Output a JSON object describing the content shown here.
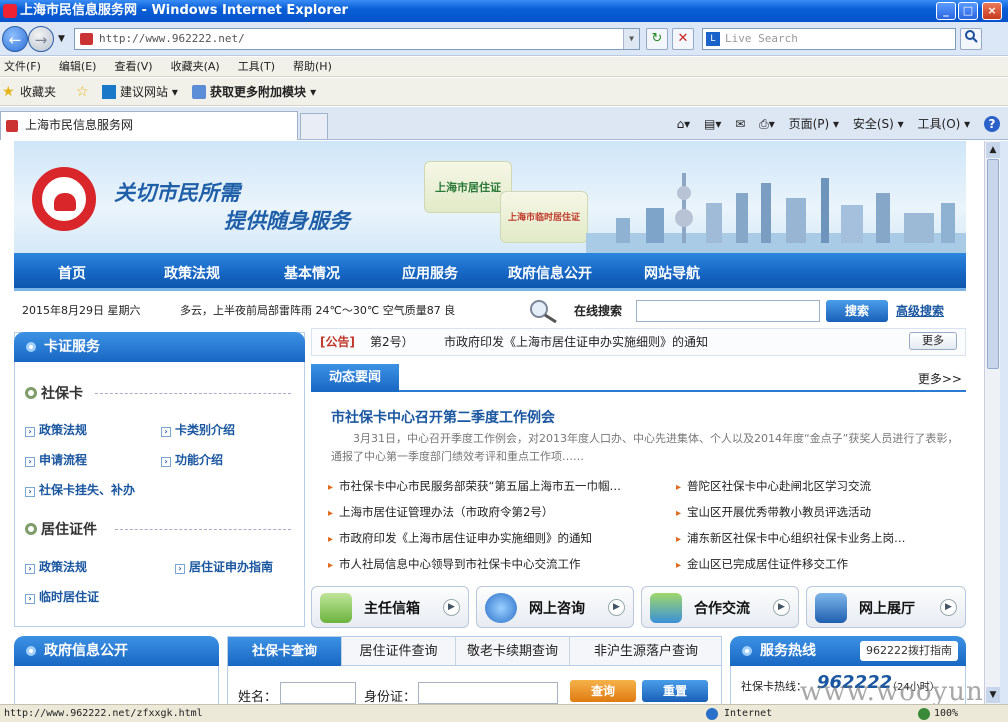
{
  "window": {
    "title": "上海市民信息服务网 - Windows Internet Explorer",
    "minimize": "_",
    "maximize": "□",
    "close": "×"
  },
  "toolbar": {
    "back": "←",
    "forward": "→",
    "url": "http://www.962222.net/",
    "refresh": "↻",
    "stop": "✕",
    "search_placeholder": "Live Search",
    "search_icon": "search-icon"
  },
  "menu": [
    "文件(F)",
    "编辑(E)",
    "查看(V)",
    "收藏夹(A)",
    "工具(T)",
    "帮助(H)"
  ],
  "favbar": {
    "favorites": "收藏夹",
    "suggested": "建议网站 ▾",
    "addons": "获取更多附加模块 ▾"
  },
  "tab": {
    "title": "上海市民信息服务网"
  },
  "commandbar": {
    "page": "页面(P) ▾",
    "safety": "安全(S) ▾",
    "tools": "工具(O) ▾",
    "help": "?"
  },
  "site": {
    "slogan1": "关切市民所需",
    "slogan2": "提供随身服务",
    "card1": "上海市居住证",
    "card2": "上海市临时居住证",
    "nav": [
      "首页",
      "政策法规",
      "基本情况",
      "应用服务",
      "政府信息公开",
      "网站导航"
    ],
    "date": "2015年8月29日  星期六",
    "weather": "多云，上半夜前局部雷阵雨 24℃～30℃ 空气质量87  良",
    "search_label": "在线搜索",
    "search_button": "搜索",
    "advanced_search": "高级搜索",
    "card_service": {
      "title": "卡证服务",
      "social_title": "社保卡",
      "social_links": [
        "政策法规",
        "卡类别介绍",
        "申请流程",
        "功能介绍",
        "社保卡挂失、补办"
      ],
      "residence_title": "居住证件",
      "residence_links": [
        "政策法规",
        "居住证申办指南",
        "临时居住证"
      ]
    },
    "notice": {
      "tag": "[公告]",
      "num": "第2号）",
      "text": "市政府印发《上海市居住证申办实施细则》的通知",
      "more": "更多"
    },
    "news": {
      "tab": "动态要闻",
      "more": "更多>>",
      "headline": "市社保卡中心召开第二季度工作例会",
      "summary": "3月31日，中心召开季度工作例会，对2013年度人口办、中心先进集体、个人以及2014年度“金点子”获奖人员进行了表彰，通报了中心第一季度部门绩效考评和重点工作项……",
      "left": [
        "市社保卡中心市民服务部荣获“第五届上海市五一巾帼…",
        "上海市居住证管理办法（市政府令第2号）",
        "市政府印发《上海市居住证申办实施细则》的通知",
        "市人社局信息中心领导到市社保卡中心交流工作"
      ],
      "right": [
        "普陀区社保卡中心赴闸北区学习交流",
        "宝山区开展优秀带教小教员评选活动",
        "浦东新区社保卡中心组织社保卡业务上岗…",
        "金山区已完成居住证件移交工作"
      ]
    },
    "buttons": [
      "主任信箱",
      "网上咨询",
      "合作交流",
      "网上展厅"
    ],
    "gov_info": "政府信息公开",
    "query_tabs": [
      "社保卡查询",
      "居住证件查询",
      "敬老卡续期查询",
      "非沪生源落户查询"
    ],
    "query": {
      "name_label": "姓名：",
      "id_label": "身份证：",
      "query_btn": "查询",
      "reset_btn": "重置"
    },
    "hotline": {
      "title": "服务热线",
      "guide": "962222拨打指南",
      "label": "社保卡热线：",
      "number": "962222",
      "hours": "（24小时）"
    }
  },
  "status": {
    "url": "http://www.962222.net/zfxxgk.html",
    "zone": "Internet",
    "zoom": "100%"
  },
  "watermark": "www.wooyun.org"
}
